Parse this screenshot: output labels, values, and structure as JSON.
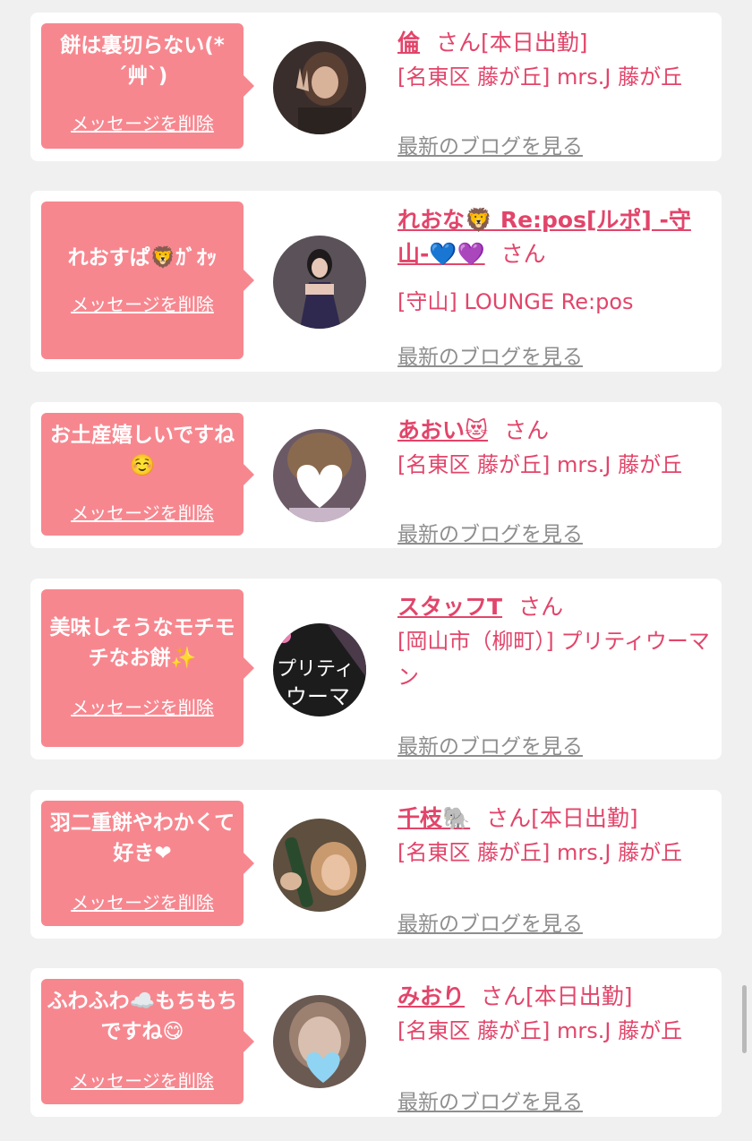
{
  "messages": [
    {
      "bubble_text": "餅は裏切らない(* ´艸`)",
      "delete_label": "メッセージを削除",
      "name": "倫",
      "suffix": "さん[本日出勤]",
      "shop": "[名東区 藤が丘] mrs.J 藤が丘",
      "blog_label": "最新のブログを見る"
    },
    {
      "bubble_text": "れおすぱ🦁ｶﾞｵｯ",
      "delete_label": "メッセージを削除",
      "name": "れおな🦁 Re:pos[ルポ] -守山-💙💜",
      "suffix": "さん",
      "shop": "[守山] LOUNGE Re:pos",
      "blog_label": "最新のブログを見る"
    },
    {
      "bubble_text": "お土産嬉しいですね☺️",
      "delete_label": "メッセージを削除",
      "name": "あおい😻",
      "suffix": "さん",
      "shop": "[名東区 藤が丘] mrs.J 藤が丘",
      "blog_label": "最新のブログを見る"
    },
    {
      "bubble_text": "美味しそうなモチモチなお餅✨",
      "delete_label": "メッセージを削除",
      "name": "スタッフT",
      "suffix": "さん",
      "shop": "[岡山市（柳町）] プリティウーマン",
      "blog_label": "最新のブログを見る"
    },
    {
      "bubble_text": "羽二重餅やわかくて好き❤",
      "delete_label": "メッセージを削除",
      "name": "千枝🐘",
      "suffix": "さん[本日出勤]",
      "shop": "[名東区 藤が丘] mrs.J 藤が丘",
      "blog_label": "最新のブログを見る"
    },
    {
      "bubble_text": "ふわふわ☁️もちもちですね😋",
      "delete_label": "メッセージを削除",
      "name": "みおり",
      "suffix": "さん[本日出勤]",
      "shop": "[名東区 藤が丘] mrs.J 藤が丘",
      "blog_label": "最新のブログを見る"
    }
  ],
  "colors": {
    "accent": "#e2456a",
    "bubble": "#f7878f",
    "muted": "#8e8e8e",
    "background": "#f0f0f0"
  }
}
